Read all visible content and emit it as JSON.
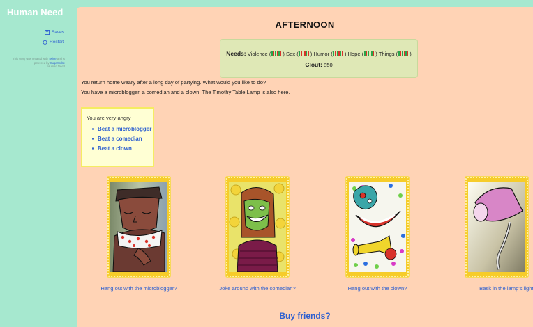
{
  "sidebar": {
    "story_title": "Human Need",
    "menu": {
      "saves": "Saves",
      "restart": "Restart"
    },
    "credits": {
      "prefix": "This story was created with",
      "twine": "Twine",
      "middle": "and is powered by",
      "sugarcube": "SugarCube",
      "suffix": "Human Need"
    }
  },
  "main": {
    "time_of_day": "AFTERNOON",
    "stats": {
      "needs_label": "Needs:",
      "needs": [
        {
          "name": "Violence"
        },
        {
          "name": "Sex"
        },
        {
          "name": "Humor"
        },
        {
          "name": "Hope"
        },
        {
          "name": "Things"
        }
      ],
      "clout_label": "Clout:",
      "clout_value": "850"
    },
    "narrative": [
      "You return home weary after a long day of partying. What would you like to do?",
      "You have a microblogger, a comedian and a clown. The Timothy Table Lamp is also here."
    ],
    "angry_box": {
      "text": "You are very angry",
      "options": [
        "Beat a microblogger",
        "Beat a comedian",
        "Beat a clown"
      ]
    },
    "cards": [
      {
        "icon": "microblogger-portrait",
        "caption": "Hang out with the microblogger?"
      },
      {
        "icon": "comedian-portrait",
        "caption": "Joke around with the comedian?"
      },
      {
        "icon": "clown-portrait",
        "caption": "Hang out with the clown?"
      },
      {
        "icon": "lamp-portrait",
        "caption": "Bask in the lamp's light?"
      }
    ],
    "buy_friends": "Buy friends?"
  },
  "colors": {
    "sidebar_bg": "#a6e8cf",
    "main_bg": "#ffd3b5",
    "link": "#2d5fd0",
    "stats_bg": "#dfe8b6",
    "angry_box_bg": "#ffffd4",
    "frame": "#f6cc2a"
  }
}
